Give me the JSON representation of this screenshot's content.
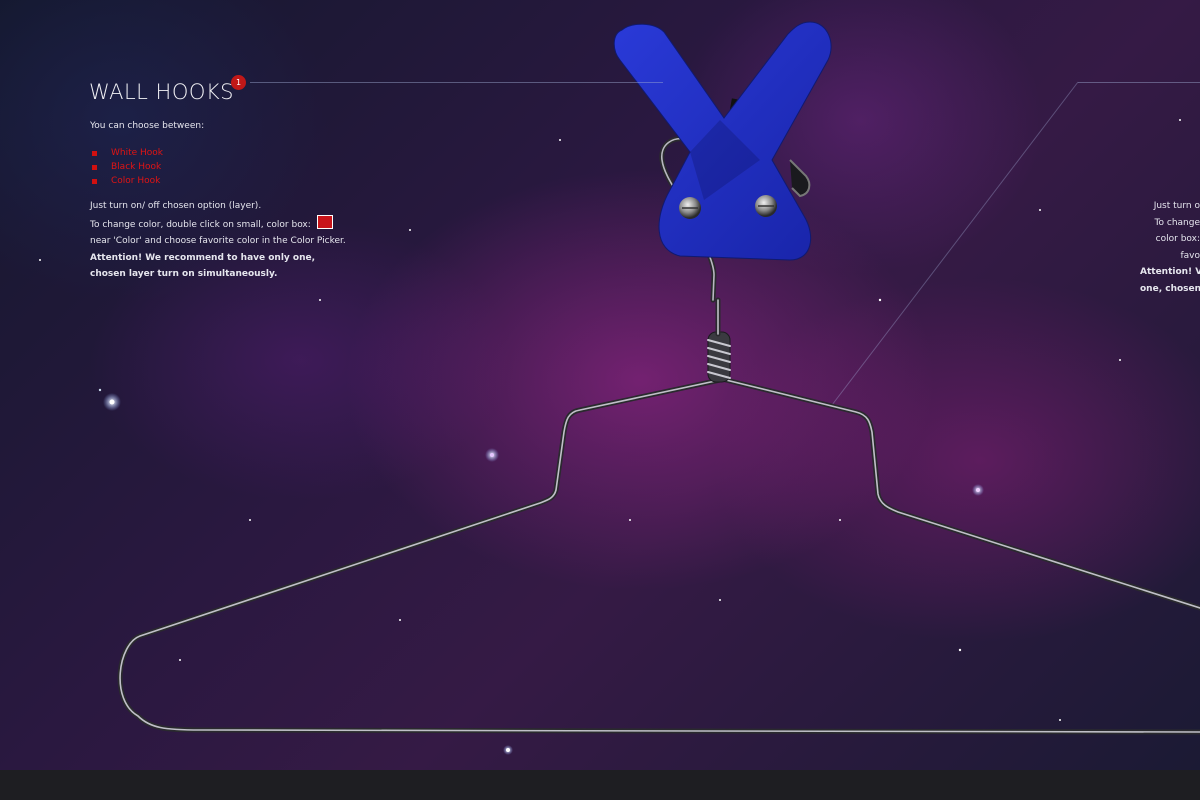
{
  "header": {
    "title": "WALL HOOKS",
    "badge": "1"
  },
  "intro": {
    "text": "You can choose between:"
  },
  "options": [
    {
      "label": "White Hook"
    },
    {
      "label": "Black Hook"
    },
    {
      "label": "Color Hook"
    }
  ],
  "instructions": {
    "line1": "Just turn on/ off chosen option (layer).",
    "line2": "To change color, double click on small, color box:",
    "line3": "near 'Color' and choose favorite color in the Color Picker.",
    "line4": "Attention! We recommend to have only one,",
    "line5": "chosen layer turn on simultaneously."
  },
  "right_panel": {
    "line1": "Just turn o",
    "line2": "To change",
    "line3": "color box:",
    "line4": "favo",
    "line5": "Attention! V",
    "line6": "one, chosen"
  },
  "colors": {
    "accent_red": "#c01818",
    "hook_blue": "#1e2fc0",
    "swatch_red": "#c8141a"
  }
}
